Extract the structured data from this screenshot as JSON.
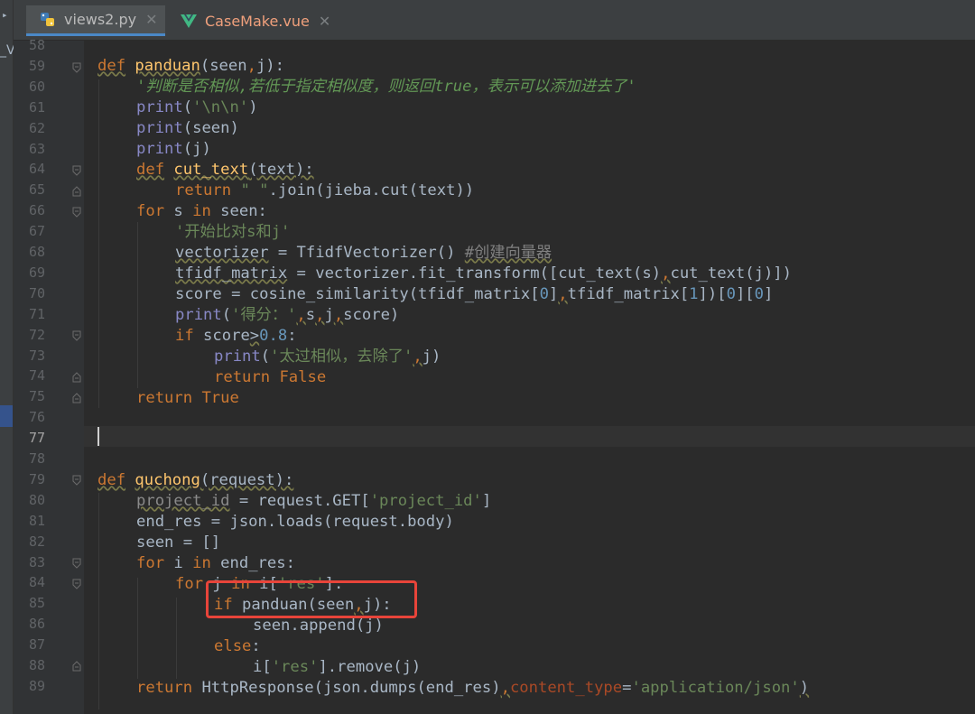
{
  "tabs": [
    {
      "label": "views2.py",
      "icon": "python-file-icon",
      "active": true
    },
    {
      "label": "CaseMake.vue",
      "icon": "vue-file-icon",
      "active": false
    }
  ],
  "sidebar": {
    "label": "_V"
  },
  "editor": {
    "current_line": 77,
    "lines": [
      {
        "n": "58"
      },
      {
        "n": "59"
      },
      {
        "n": "60"
      },
      {
        "n": "61"
      },
      {
        "n": "62"
      },
      {
        "n": "63"
      },
      {
        "n": "64"
      },
      {
        "n": "65"
      },
      {
        "n": "66"
      },
      {
        "n": "67"
      },
      {
        "n": "68"
      },
      {
        "n": "69"
      },
      {
        "n": "70"
      },
      {
        "n": "71"
      },
      {
        "n": "72"
      },
      {
        "n": "73"
      },
      {
        "n": "74"
      },
      {
        "n": "75"
      },
      {
        "n": "76"
      },
      {
        "n": "77"
      },
      {
        "n": "78"
      },
      {
        "n": "79"
      },
      {
        "n": "80"
      },
      {
        "n": "81"
      },
      {
        "n": "82"
      },
      {
        "n": "83"
      },
      {
        "n": "84"
      },
      {
        "n": "85"
      },
      {
        "n": "86"
      },
      {
        "n": "87"
      },
      {
        "n": "88"
      },
      {
        "n": "89"
      }
    ],
    "code": {
      "l59": [
        "def",
        " ",
        "panduan",
        "(seen",
        ",",
        "j):"
      ],
      "l60": "'判断是否相似,若低于指定相似度，则返回true，表示可以添加进去了'",
      "l61": [
        "print",
        "(",
        "'\\n\\n'",
        ")"
      ],
      "l62": [
        "print",
        "(seen)"
      ],
      "l63": [
        "print",
        "(j)"
      ],
      "l64": [
        "def",
        " ",
        "cut_text",
        "(text):"
      ],
      "l65": [
        "return",
        " ",
        "\" \"",
        ".join(jieba.cut(text))"
      ],
      "l66": [
        "for",
        " s ",
        "in",
        " seen:"
      ],
      "l67": "'开始比对s和j'",
      "l68": [
        "vectorizer",
        " = TfidfVectorizer() ",
        "#创建向量器"
      ],
      "l69": [
        "tfidf_matrix",
        " = vectorizer.fit_transform([cut_text(s)",
        ",",
        "cut_text(j)])"
      ],
      "l70": [
        "score = cosine_similarity(tfidf_matrix[",
        "0",
        "]",
        ",",
        "tfidf_matrix[",
        "1",
        "])[",
        "0",
        "][",
        "0",
        "]"
      ],
      "l71": [
        "print",
        "(",
        "'得分：'",
        ",",
        "s",
        ",",
        "j",
        ",",
        "score)"
      ],
      "l72": [
        "if",
        " score",
        ">",
        "0.8",
        ":"
      ],
      "l73": [
        "print",
        "(",
        "'太过相似，去除了'",
        ",",
        "j)"
      ],
      "l74": [
        "return",
        " ",
        "False"
      ],
      "l75": [
        "return",
        " ",
        "True"
      ],
      "l79": [
        "def",
        " ",
        "quchong",
        "(request):"
      ],
      "l80": [
        "project_id",
        " = request.GET[",
        "'project_id'",
        "]"
      ],
      "l81": "end_res = json.loads(request.body)",
      "l82": "seen = []",
      "l83": [
        "for",
        " i ",
        "in",
        " end_res:"
      ],
      "l84": [
        "for",
        " j ",
        "in",
        " i[",
        "'res'",
        "]:"
      ],
      "l85": [
        "if",
        " panduan(seen",
        ",",
        "j):"
      ],
      "l86": "seen.append(j)",
      "l87": [
        "else",
        ":"
      ],
      "l88": [
        "i[",
        "'res'",
        "].remove(j)"
      ],
      "l89": [
        "return",
        " HttpResponse(json.dumps(end_res)",
        ",",
        "content_type",
        "=",
        "'application/json'",
        ")"
      ]
    }
  },
  "highlight_box_color": "#e8443a"
}
